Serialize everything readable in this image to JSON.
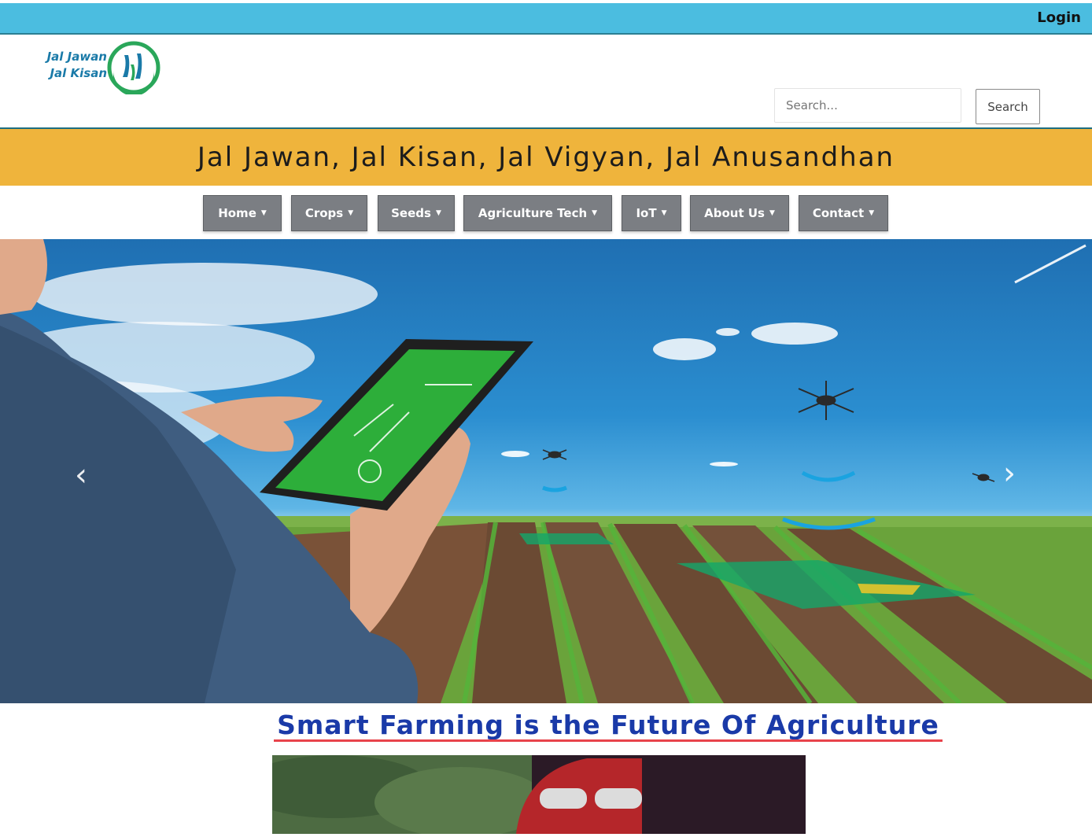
{
  "topbar": {
    "login_label": "Login"
  },
  "header": {
    "logo_line1": "Jal Jawan",
    "logo_line2": "Jal Kisan",
    "search": {
      "placeholder": "Search...",
      "button_label": "Search"
    }
  },
  "slogan": "Jal Jawan, Jal Kisan, Jal Vigyan, Jal Anusandhan",
  "nav": {
    "items": [
      {
        "label": "Home",
        "icon": "caret-down-icon"
      },
      {
        "label": "Crops",
        "icon": "caret-down-icon"
      },
      {
        "label": "Seeds",
        "icon": "caret-down-icon"
      },
      {
        "label": "Agriculture Tech",
        "icon": "caret-down-icon"
      },
      {
        "label": "IoT",
        "icon": "caret-down-icon"
      },
      {
        "label": "About Us",
        "icon": "caret-down-icon"
      },
      {
        "label": "Contact",
        "icon": "caret-down-icon"
      }
    ]
  },
  "hero": {
    "prev_icon": "chevron-left-icon",
    "next_icon": "chevron-right-icon"
  },
  "feature": {
    "title": "Smart Farming is the Future Of Agriculture"
  },
  "colors": {
    "topbar": "#4bbde0",
    "slogan_bar": "#efb43c",
    "nav_button": "#7b7e83",
    "feature_title": "#1a3aa8",
    "feature_underline": "#e8434b"
  }
}
